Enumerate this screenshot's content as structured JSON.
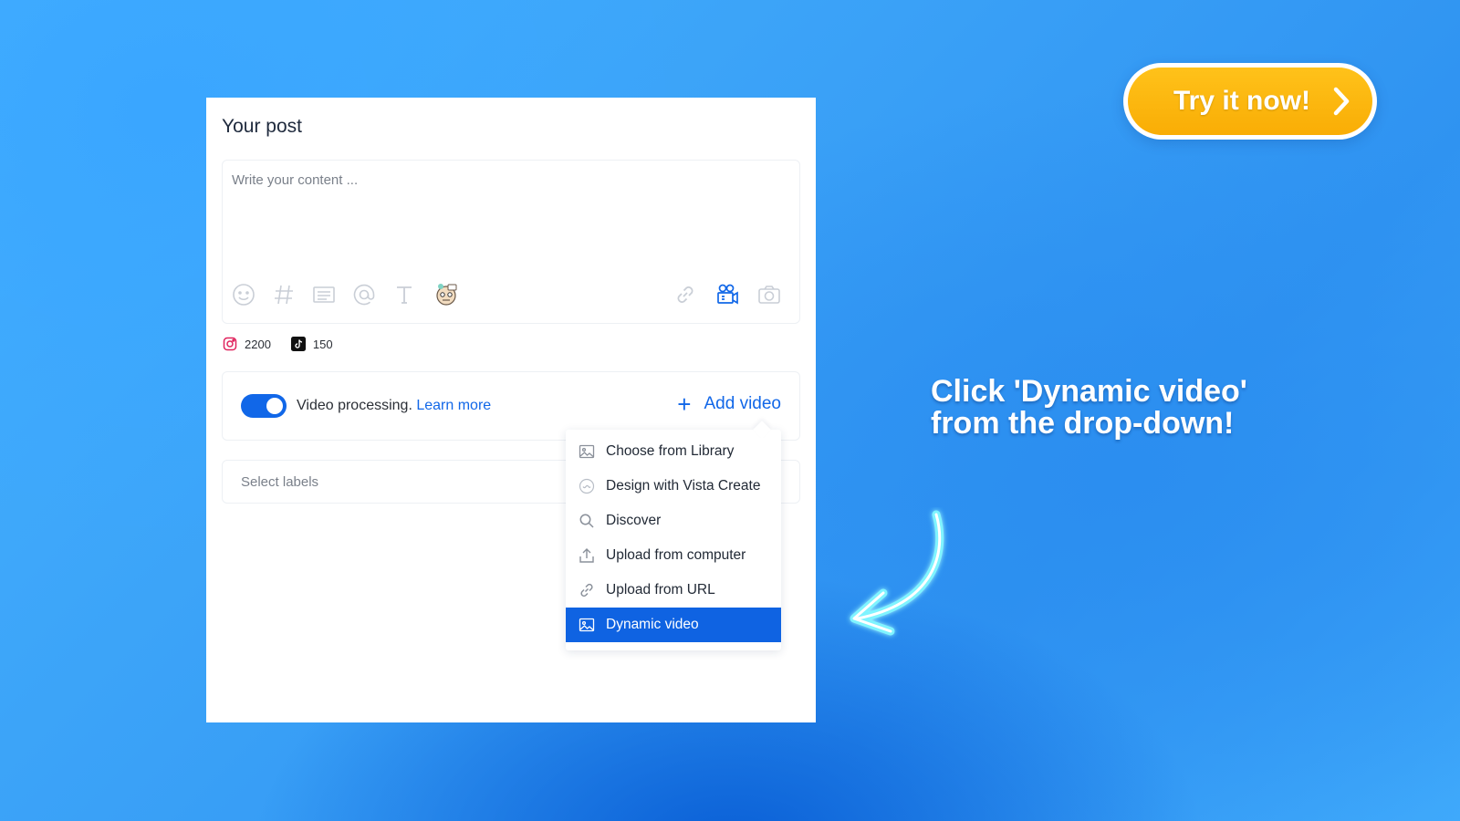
{
  "composer": {
    "title": "Your post",
    "editor_placeholder": "Write your content ...",
    "toolbar_left": [
      "emoji-icon",
      "hashtag-icon",
      "templates-icon",
      "mention-icon",
      "text-format-icon",
      "ai-assistant-icon"
    ],
    "toolbar_right": [
      "link-icon",
      "video-icon",
      "camera-icon"
    ],
    "counters": [
      {
        "network": "instagram-icon",
        "value": "2200"
      },
      {
        "network": "tiktok-icon",
        "value": "150"
      }
    ],
    "video_processing": {
      "enabled": true,
      "label": "Video processing.",
      "link": "Learn more"
    },
    "add_video_label": "Add video",
    "labels_placeholder": "Select labels"
  },
  "dropdown": {
    "items": [
      {
        "label": "Choose from Library",
        "icon": "image-icon"
      },
      {
        "label": "Design with Vista Create",
        "icon": "vista-create-icon"
      },
      {
        "label": "Discover",
        "icon": "search-icon"
      },
      {
        "label": "Upload from computer",
        "icon": "upload-icon"
      },
      {
        "label": "Upload from URL",
        "icon": "link-icon"
      },
      {
        "label": "Dynamic video",
        "icon": "image-icon",
        "active": true
      }
    ]
  },
  "cta": {
    "label": "Try it now!",
    "color": "#f9ad05"
  },
  "instruction": {
    "line1": "Click 'Dynamic video'",
    "line2": "from the drop-down!"
  },
  "colors": {
    "accent": "#1167e8",
    "active_item": "#0f63e2"
  }
}
